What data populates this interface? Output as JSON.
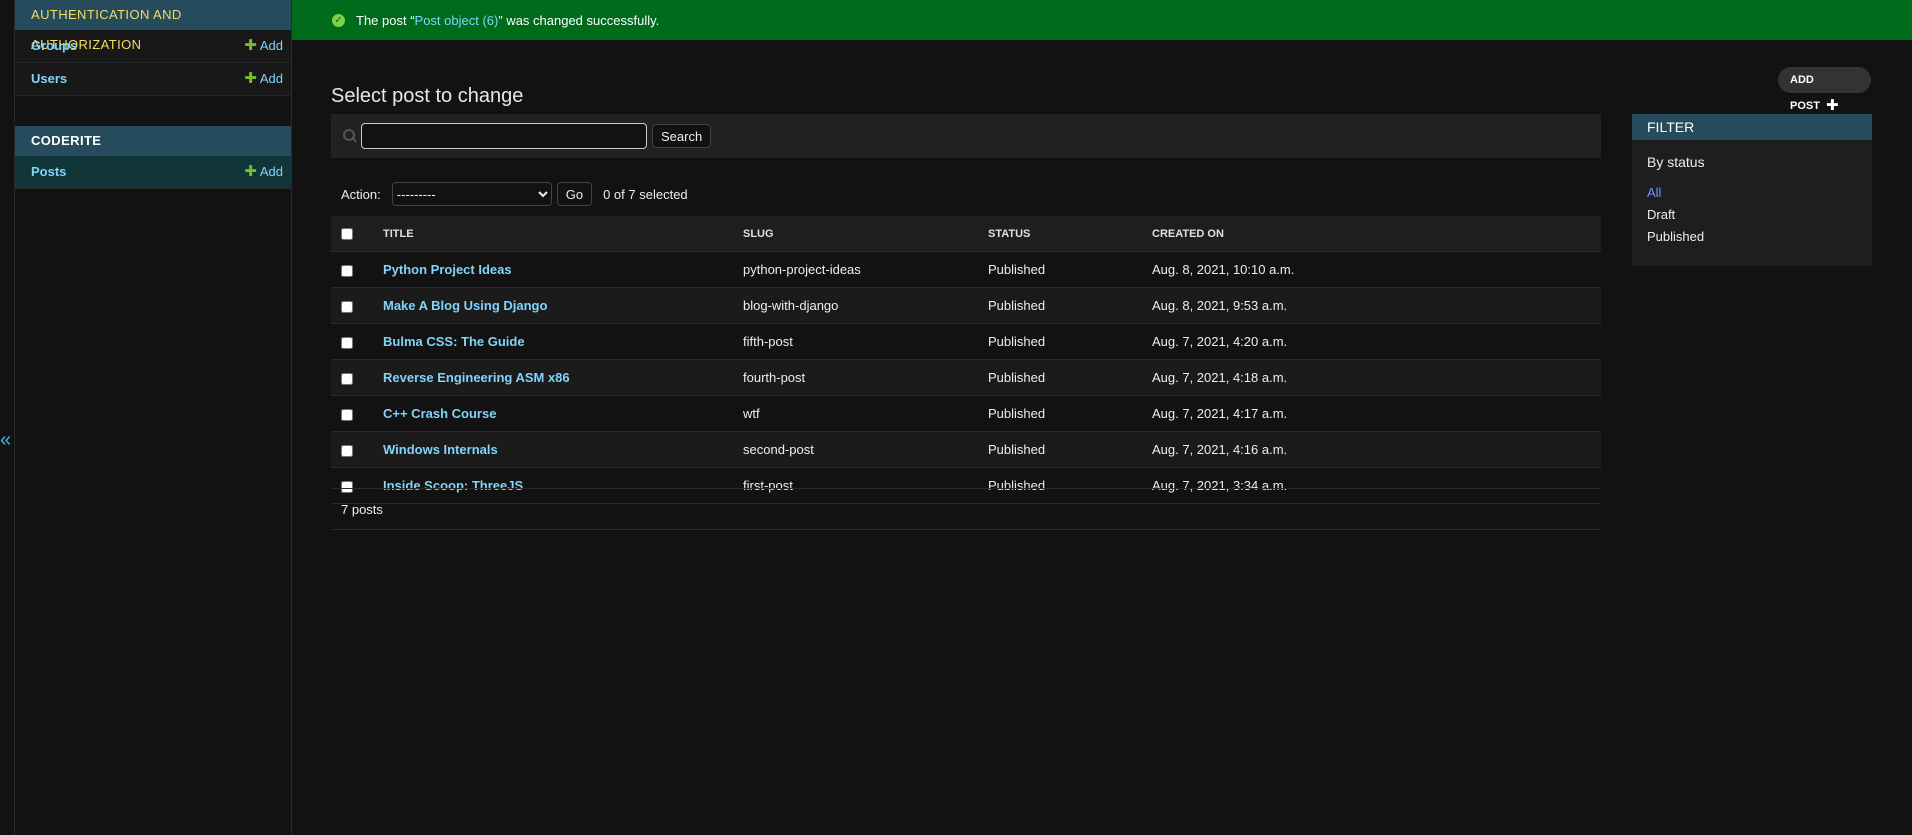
{
  "sidebar": {
    "modules": [
      {
        "caption": "Authentication and Authorization",
        "rows": [
          {
            "label": "Groups",
            "add": "Add"
          },
          {
            "label": "Users",
            "add": "Add"
          }
        ]
      },
      {
        "caption": "Coderite",
        "rows": [
          {
            "label": "Posts",
            "add": "Add"
          }
        ]
      }
    ],
    "collapse_glyph": "«"
  },
  "banner": {
    "prefix": "The post “",
    "link": "Post object (6)",
    "suffix": "” was changed successfully."
  },
  "page": {
    "title": "Select post to change",
    "add_button": "ADD POST",
    "search_button": "Search",
    "search_value": "",
    "action_label": "Action:",
    "action_selected": "---------",
    "go_button": "Go",
    "selected_counter": "0 of 7 selected",
    "paginator": "7 posts"
  },
  "table": {
    "headers": [
      "Title",
      "Slug",
      "Status",
      "Created on"
    ],
    "rows": [
      {
        "title": "Python Project Ideas",
        "slug": "python-project-ideas",
        "status": "Published",
        "created": "Aug. 8, 2021, 10:10 a.m."
      },
      {
        "title": "Make A Blog Using Django",
        "slug": "blog-with-django",
        "status": "Published",
        "created": "Aug. 8, 2021, 9:53 a.m."
      },
      {
        "title": "Bulma CSS: The Guide",
        "slug": "fifth-post",
        "status": "Published",
        "created": "Aug. 7, 2021, 4:20 a.m."
      },
      {
        "title": "Reverse Engineering ASM x86",
        "slug": "fourth-post",
        "status": "Published",
        "created": "Aug. 7, 2021, 4:18 a.m."
      },
      {
        "title": "C++ Crash Course",
        "slug": "wtf",
        "status": "Published",
        "created": "Aug. 7, 2021, 4:17 a.m."
      },
      {
        "title": "Windows Internals",
        "slug": "second-post",
        "status": "Published",
        "created": "Aug. 7, 2021, 4:16 a.m."
      },
      {
        "title": "Inside Scoop: ThreeJS",
        "slug": "first-post",
        "status": "Published",
        "created": "Aug. 7, 2021, 3:34 a.m."
      }
    ]
  },
  "filter": {
    "heading": "FILTER",
    "subheading": "By status",
    "options": [
      "All",
      "Draft",
      "Published"
    ]
  },
  "colors": {
    "banner_bg": "#006b1b",
    "caption_bg": "#264b5d",
    "link": "#81d4fa",
    "add_plus": "#70bf2b"
  },
  "icons": [
    "success-check-icon",
    "plus-icon",
    "search-icon",
    "chevron-down-icon",
    "collapse-sidebar-icon"
  ]
}
